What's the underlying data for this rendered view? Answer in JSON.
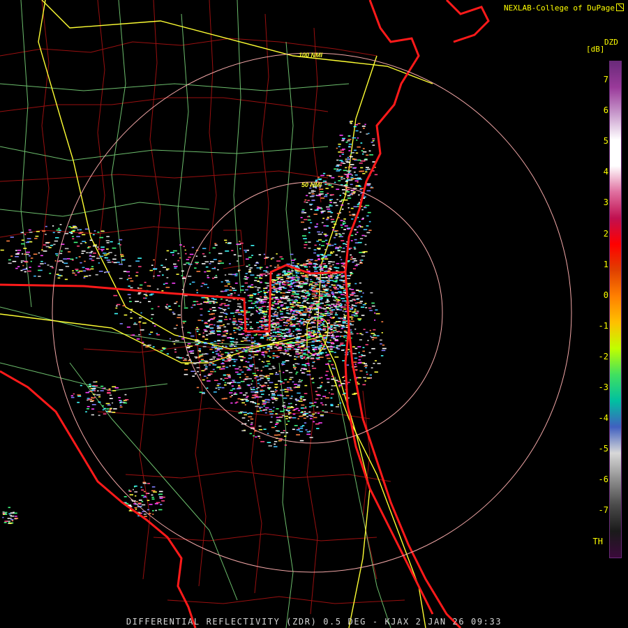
{
  "credit": "NEXLAB-College of DuPage",
  "legend": {
    "title": "DZD",
    "unit": "[dB]",
    "ticks": [
      "7",
      "6",
      "5",
      "4",
      "3",
      "2",
      "1",
      "0",
      "-1",
      "-2",
      "-3",
      "-4",
      "-5",
      "-6",
      "-7",
      "TH"
    ],
    "colors": [
      "#6a2a7a",
      "#9a3a9a",
      "#c89acc",
      "#ffffff",
      "#ffffff",
      "#e070a0",
      "#c01050",
      "#ff0000",
      "#e04000",
      "#ff8000",
      "#ffc000",
      "#c0ff00",
      "#40e060",
      "#00c0a0",
      "#4060c0",
      "#d8d8d8",
      "#909090",
      "#4a4a4a",
      "#1a1a1a",
      "#3a0a3a"
    ]
  },
  "range_rings": {
    "inner_label": "50 NMI",
    "outer_label": "100 NMI"
  },
  "caption": "DIFFERENTIAL REFLECTIVITY (ZDR) 0.5 DEG - KJAX 2 JAN 26 09:33",
  "colors": {
    "coast": "#ff1a1a",
    "county": "#a01010",
    "roads_primary": "#ffff40",
    "roads_secondary": "#90ee90",
    "ring": "#f4a8a8"
  }
}
